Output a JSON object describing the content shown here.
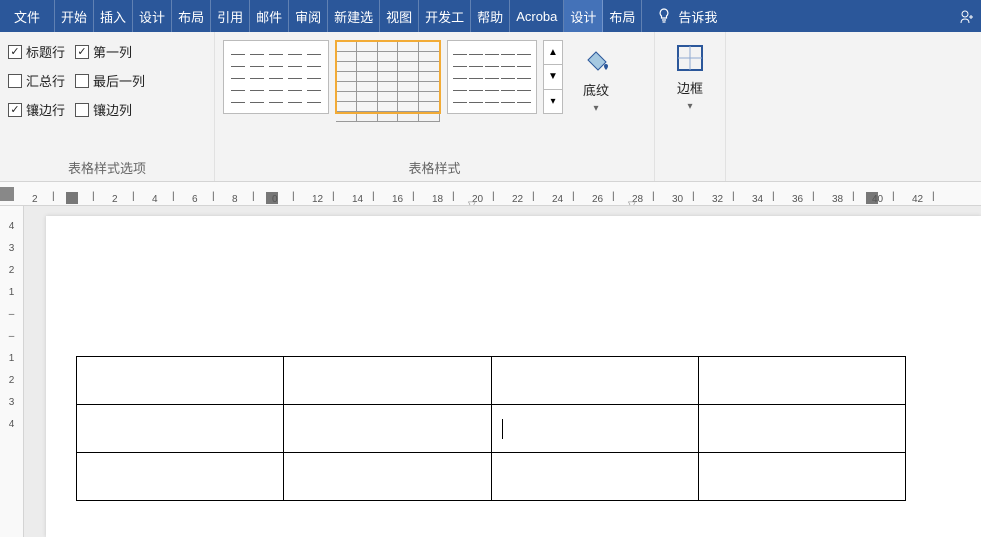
{
  "tabs": {
    "file": "文件",
    "home": "开始",
    "insert": "插入",
    "design": "设计",
    "layout": "布局",
    "references": "引用",
    "mailings": "邮件",
    "review": "审阅",
    "newtab": "新建选",
    "view": "视图",
    "developer": "开发工",
    "help": "帮助",
    "acrobat": "Acroba",
    "tool_design": "设计",
    "tool_layout": "布局",
    "tellme": "告诉我"
  },
  "ribbon": {
    "style_options": {
      "header_row": "标题行",
      "first_column": "第一列",
      "total_row": "汇总行",
      "last_column": "最后一列",
      "banded_rows": "镶边行",
      "banded_columns": "镶边列",
      "group_label": "表格样式选项"
    },
    "table_styles_label": "表格样式",
    "shading": "底纹",
    "borders": "边框"
  },
  "checkbox_states": {
    "header_row": true,
    "first_column": true,
    "total_row": false,
    "last_column": false,
    "banded_rows": true,
    "banded_columns": false
  },
  "ruler_h": [
    "2",
    "",
    "2",
    "4",
    "6",
    "8",
    "0",
    "2",
    "4",
    "6",
    "8",
    "20",
    "22",
    "24",
    "26",
    "28",
    "30",
    "32",
    "34",
    "36",
    "38",
    "40",
    "42"
  ],
  "ruler_h_display": [
    {
      "n": "2"
    },
    {
      "n": "",
      "mark": true
    },
    {
      "n": "2"
    },
    {
      "n": "4"
    },
    {
      "n": "6"
    },
    {
      "n": "8"
    },
    {
      "n": "0",
      "mark": true
    },
    {
      "n": "12"
    },
    {
      "n": "14"
    },
    {
      "n": "16"
    },
    {
      "n": "18"
    },
    {
      "n": "20",
      "ind": true
    },
    {
      "n": "22"
    },
    {
      "n": "24"
    },
    {
      "n": "26"
    },
    {
      "n": "28",
      "ind": true
    },
    {
      "n": "30"
    },
    {
      "n": "32"
    },
    {
      "n": "34"
    },
    {
      "n": "36"
    },
    {
      "n": "38"
    },
    {
      "n": "40",
      "mark": true
    },
    {
      "n": "42"
    }
  ],
  "ruler_v": [
    "4",
    "3",
    "2",
    "1",
    "",
    "",
    "1",
    "2",
    "3",
    "4"
  ],
  "document": {
    "table": {
      "rows": 3,
      "cols": 4
    }
  }
}
